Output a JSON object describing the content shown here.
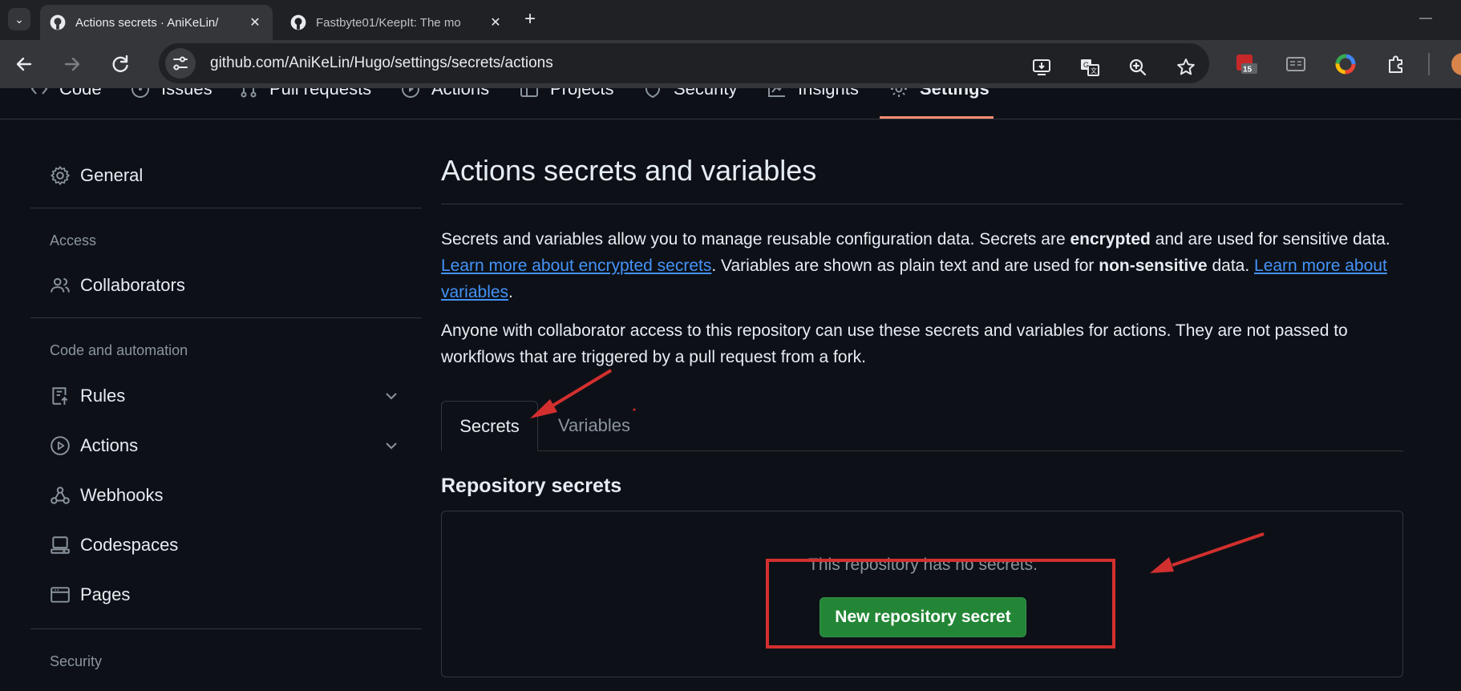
{
  "browser": {
    "tabs": [
      {
        "title": "Actions secrets · AniKeLin/",
        "active": true
      },
      {
        "title": "Fastbyte01/KeepIt: The mo",
        "active": false
      }
    ],
    "url": "github.com/AniKeLin/Hugo/settings/secrets/actions",
    "extension_badge": "15"
  },
  "repo_nav": {
    "items": [
      {
        "label": "Code",
        "icon": "code-icon"
      },
      {
        "label": "Issues",
        "icon": "issue-icon"
      },
      {
        "label": "Pull requests",
        "icon": "pull-request-icon"
      },
      {
        "label": "Actions",
        "icon": "play-icon"
      },
      {
        "label": "Projects",
        "icon": "table-icon"
      },
      {
        "label": "Security",
        "icon": "shield-icon"
      },
      {
        "label": "Insights",
        "icon": "graph-icon"
      },
      {
        "label": "Settings",
        "icon": "gear-icon",
        "selected": true
      }
    ],
    "selected_underline_color": "#fd8c73"
  },
  "sidebar": {
    "general": "General",
    "access_heading": "Access",
    "collaborators": "Collaborators",
    "code_heading": "Code and automation",
    "rules": "Rules",
    "actions": "Actions",
    "webhooks": "Webhooks",
    "codespaces": "Codespaces",
    "pages": "Pages",
    "security_heading": "Security"
  },
  "main": {
    "title": "Actions secrets and variables",
    "intro": {
      "t1": "Secrets and variables allow you to manage reusable configuration data. Secrets are ",
      "b1": "encrypted",
      "t2": " and are used for sensitive data. ",
      "link1": "Learn more about encrypted secrets",
      "t3": ". Variables are shown as plain text and are used for ",
      "b2": "non-sensitive",
      "t4": " data. ",
      "link2": "Learn more about variables",
      "t5": "."
    },
    "access_note": "Anyone with collaborator access to this repository can use these secrets and variables for actions. They are not passed to workflows that are triggered by a pull request from a fork.",
    "tabs": [
      "Secrets",
      "Variables"
    ],
    "section_title": "Repository secrets",
    "empty_text": "This repository has no secrets.",
    "new_button": "New repository secret"
  },
  "colors": {
    "page_bg": "#0d1117",
    "link": "#4493f8",
    "primary_button": "#238636",
    "annotation": "#d32f2f"
  }
}
